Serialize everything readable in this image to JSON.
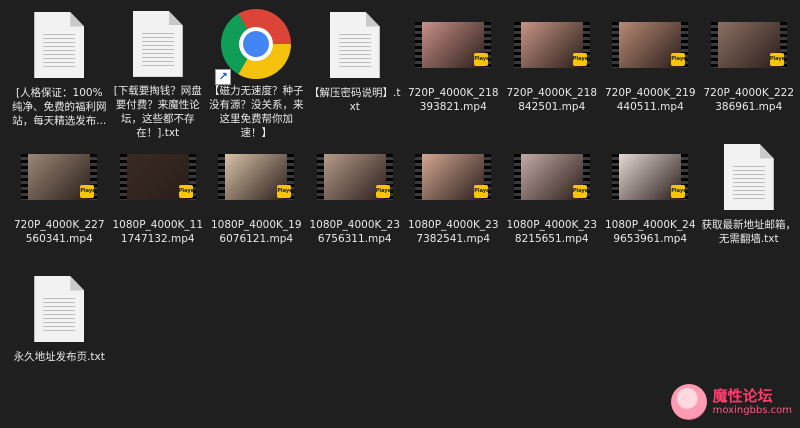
{
  "files": [
    {
      "type": "doc",
      "label": "[人格保证：100%纯净、免费的福利网站，每天精选发布..."
    },
    {
      "type": "doc",
      "label": "[下载要掏钱？网盘要付费？来魔性论坛，这些都不存在！].txt"
    },
    {
      "type": "chrome",
      "label": "【磁力无速度？种子没有源？没关系，来这里免费帮你加速！】"
    },
    {
      "type": "doc",
      "label": "【解压密码说明】.txt"
    },
    {
      "type": "video",
      "label": "720P_4000K_218393821.mp4",
      "tint": "#c98f8a",
      "badge": "Player"
    },
    {
      "type": "video",
      "label": "720P_4000K_218842501.mp4",
      "tint": "#c79484",
      "badge": "Player"
    },
    {
      "type": "video",
      "label": "720P_4000K_219440511.mp4",
      "tint": "#b88a74",
      "badge": "Player"
    },
    {
      "type": "video",
      "label": "720P_4000K_222386961.mp4",
      "tint": "#8c6f63",
      "badge": "Player"
    },
    {
      "type": "video",
      "label": "720P_4000K_227560341.mp4",
      "tint": "#9b8877",
      "badge": "Player"
    },
    {
      "type": "video",
      "label": "1080P_4000K_111747132.mp4",
      "tint": "#3a2a22",
      "badge": "Player"
    },
    {
      "type": "video",
      "label": "1080P_4000K_196076121.mp4",
      "tint": "#d8c2a8",
      "badge": "Player"
    },
    {
      "type": "video",
      "label": "1080P_4000K_236756311.mp4",
      "tint": "#b49a8a",
      "badge": "Player"
    },
    {
      "type": "video",
      "label": "1080P_4000K_237382541.mp4",
      "tint": "#d2a692",
      "badge": "Player"
    },
    {
      "type": "video",
      "label": "1080P_4000K_238215651.mp4",
      "tint": "#c4aaa6",
      "badge": "Player"
    },
    {
      "type": "video",
      "label": "1080P_4000K_249653961.mp4",
      "tint": "#e4dad4",
      "badge": "Player"
    },
    {
      "type": "doc",
      "label": "获取最新地址邮箱，无需翻墙.txt"
    },
    {
      "type": "doc",
      "label": "永久地址发布页.txt"
    }
  ],
  "watermark": {
    "title": "魔性论坛",
    "url": "moxingbbs.com"
  }
}
